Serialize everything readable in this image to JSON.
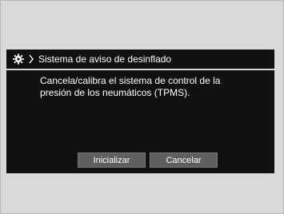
{
  "header": {
    "title": "Sistema de aviso de desinflado",
    "icon": "gear-icon",
    "separator_icon": "chevron-right-icon"
  },
  "message": {
    "lines": [
      "Cancela/calibra el sistema de control de la",
      "presión de los neumáticos (TPMS)."
    ]
  },
  "buttons": {
    "initialize_label": "Inicializar",
    "cancel_label": "Cancelar"
  },
  "colors": {
    "screen_background": "#111111",
    "outer_background": "#d9d9d9",
    "button_background": "#5f5f5f",
    "text": "#ffffff"
  }
}
